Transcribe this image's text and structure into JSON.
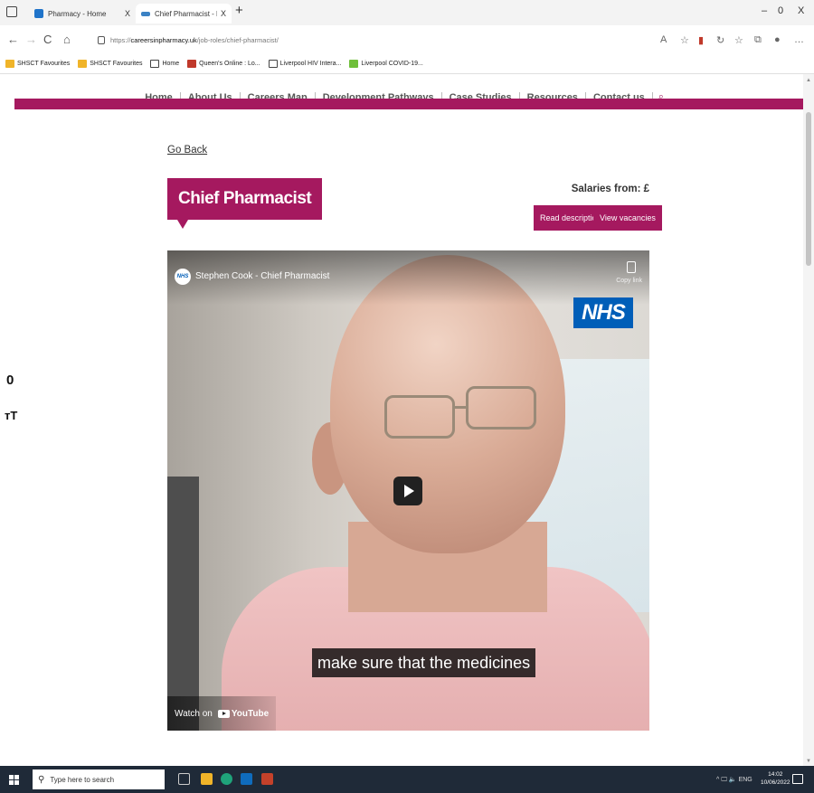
{
  "browser": {
    "tabs": [
      {
        "label": "Pharmacy - Home",
        "favicon_color": "#1f73c9",
        "active": false
      },
      {
        "label": "Chief Pharmacist - Pharmacy Ca",
        "favicon_color": "#3b82c4",
        "active": true
      }
    ],
    "tab_close_glyph": "X",
    "new_tab_glyph": "+",
    "window_controls": {
      "minimize": "–",
      "restore": "0",
      "close": "X"
    },
    "nav": {
      "back": "←",
      "forward": "→",
      "refresh": "C",
      "home": "⌂"
    },
    "url": {
      "prefix": "https://",
      "host": "careersinpharmacy.uk",
      "path": "/job-roles/chief-pharmacist/"
    },
    "toolbar_icons": [
      "read-aloud-icon",
      "favorites-star-icon",
      "extension-icon",
      "refresh-icon",
      "favorites-list-icon",
      "collections-icon",
      "profile-icon",
      "more-icon"
    ],
    "bookmarks": [
      {
        "label": "SHSCT Favourites",
        "icon": "folder-icon"
      },
      {
        "label": "SHSCT Favourites",
        "icon": "folder-icon"
      },
      {
        "label": "Home",
        "icon": "page-icon"
      },
      {
        "label": "Queen's Online : Lo...",
        "icon": "shield-icon"
      },
      {
        "label": "Liverpool HIV Intera...",
        "icon": "page-icon"
      },
      {
        "label": "Liverpool COVID-19...",
        "icon": "green-square-icon"
      }
    ]
  },
  "site": {
    "nav_items": [
      "Home",
      "About Us",
      "Careers Map",
      "Development Pathways",
      "Case Studies",
      "Resources",
      "Contact us"
    ],
    "go_back": "Go Back",
    "title": "Chief Pharmacist",
    "salaries_label": "Salaries from: £",
    "read_description": "Read description",
    "view_vacancies": "View vacancies",
    "video": {
      "channel_avatar": "NHS",
      "title": "Stephen Cook - Chief Pharmacist",
      "copy_link": "Copy link",
      "logo": "NHS",
      "caption": "make sure that the medicines",
      "watch_on": "Watch on",
      "youtube": "YouTube"
    },
    "side_tools": {
      "contrast": "◐",
      "text_size": "ᴛT"
    }
  },
  "colors": {
    "brand": "#a5195f",
    "nhs_blue": "#005eb8",
    "taskbar": "#1f2a38"
  },
  "taskbar": {
    "search_placeholder": "Type here to search",
    "tray": "^ 🖵 🔈 ENG",
    "time": "14:02",
    "date": "10/06/2022"
  }
}
